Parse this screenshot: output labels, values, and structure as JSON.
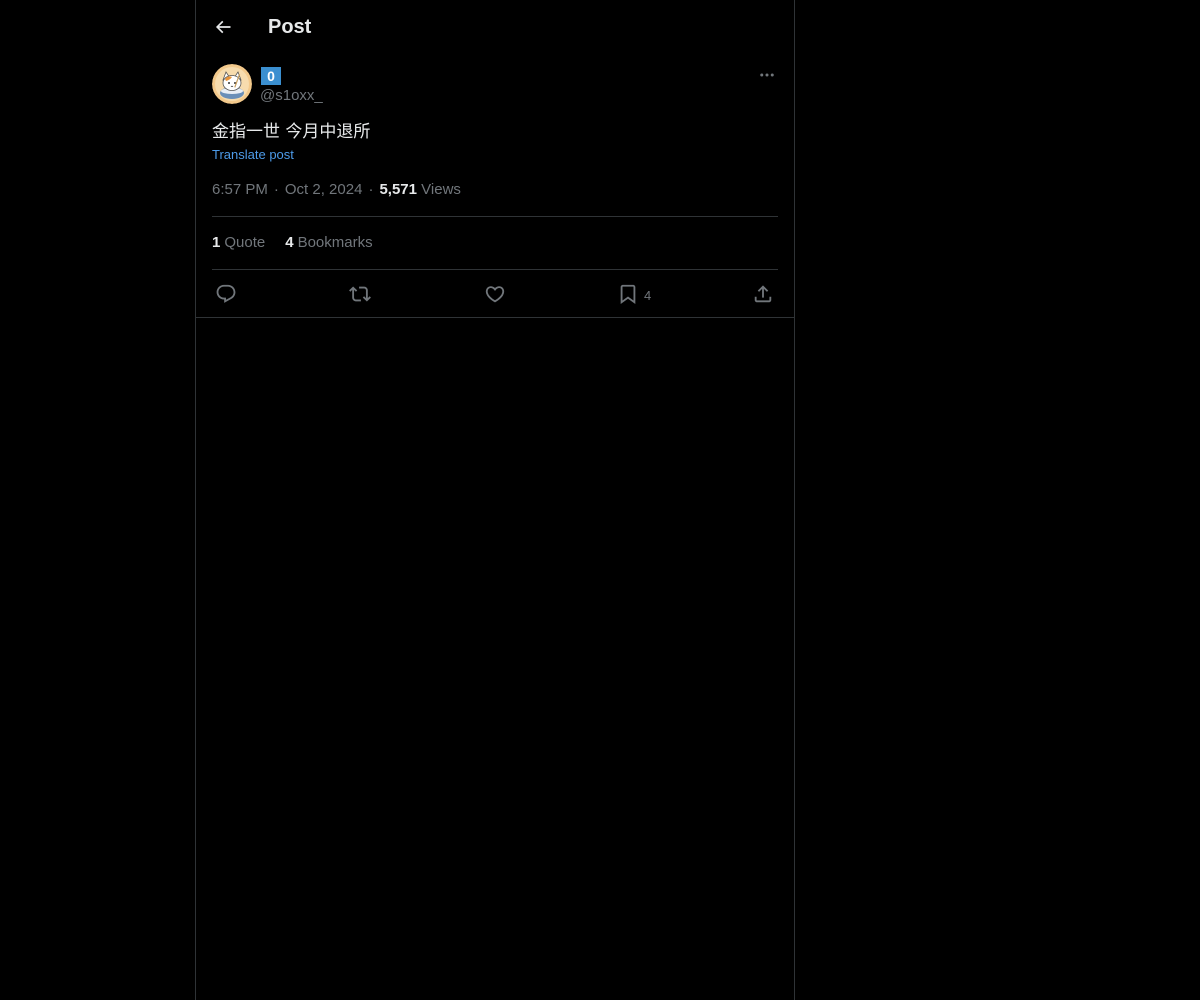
{
  "header": {
    "back_icon": "arrow-left-icon",
    "title": "Post"
  },
  "post": {
    "avatar_icon": "cat-avatar",
    "display_name": "0",
    "handle": "@s1oxx_",
    "more_icon": "more-horizontal-icon",
    "text": "金指一世 今月中退所",
    "translate_label": "Translate post",
    "time": "6:57 PM",
    "date": "Oct 2, 2024",
    "views_count": "5,571",
    "views_label": "Views",
    "quotes_count": "1",
    "quotes_label": "Quote",
    "bookmarks_count": "4",
    "bookmarks_label": "Bookmarks"
  },
  "actions": {
    "reply_icon": "reply-icon",
    "repost_icon": "repost-icon",
    "like_icon": "heart-icon",
    "bookmark_icon": "bookmark-icon",
    "bookmark_count": "4",
    "share_icon": "share-icon"
  },
  "colors": {
    "background": "#000000",
    "text_primary": "#e7e9ea",
    "text_secondary": "#71767b",
    "link": "#4d9be9",
    "border": "#2f3336",
    "badge": "#3b8fd0"
  }
}
